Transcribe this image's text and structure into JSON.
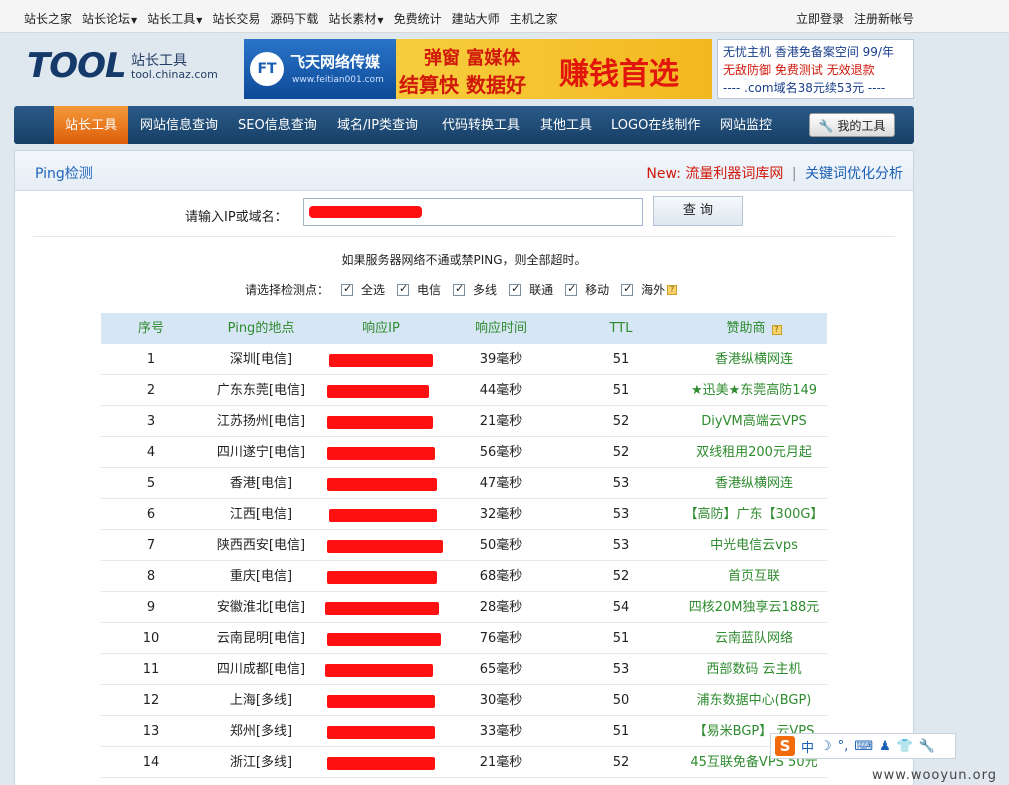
{
  "topbar": {
    "links": [
      {
        "label": "站长之家",
        "dropdown": false
      },
      {
        "label": "站长论坛",
        "dropdown": true
      },
      {
        "label": "站长工具",
        "dropdown": true
      },
      {
        "label": "站长交易",
        "dropdown": false
      },
      {
        "label": "源码下载",
        "dropdown": false
      },
      {
        "label": "站长素材",
        "dropdown": true
      },
      {
        "label": "免费统计",
        "dropdown": false
      },
      {
        "label": "建站大师",
        "dropdown": false
      },
      {
        "label": "主机之家",
        "dropdown": false
      }
    ],
    "login": "立即登录",
    "register": "注册新帐号"
  },
  "header": {
    "logo_text": "TOOL",
    "logo_cn": "站长工具",
    "logo_url": "tool.chinaz.com",
    "banner": {
      "badge": "FT",
      "brand": "飞天网络传媒",
      "brand_url": "www.feitian001.com",
      "line1": "弹窗 富媒体",
      "line2": "结算快 数据好",
      "slogan": "赚钱首选"
    },
    "text_ad": {
      "line1": "无忧主机 香港免备案空间 99/年",
      "line2": "无敌防御 免费测试 无效退款",
      "line3": "---- .com域名38元续53元 ----"
    }
  },
  "nav": {
    "items": [
      "站长工具",
      "网站信息查询",
      "SEO信息查询",
      "域名/IP类查询",
      "代码转换工具",
      "其他工具",
      "LOGO在线制作",
      "网站监控"
    ],
    "my_tools": "我的工具"
  },
  "page": {
    "title": "Ping检测",
    "new_label": "New:",
    "promo1": "流量利器词库网",
    "promo2": "关键词优化分析",
    "input_label": "请输入IP或域名：",
    "search_button": "查 询",
    "notice": "如果服务器网络不通或禁PING，则全部超时。",
    "select_label": "请选择检测点：",
    "checkboxes": [
      {
        "label": "全选",
        "checked": true
      },
      {
        "label": "电信",
        "checked": true
      },
      {
        "label": "多线",
        "checked": true
      },
      {
        "label": "联通",
        "checked": true
      },
      {
        "label": "移动",
        "checked": true
      },
      {
        "label": "海外",
        "checked": true
      }
    ]
  },
  "table": {
    "headers": [
      "序号",
      "Ping的地点",
      "响应IP",
      "响应时间",
      "TTL",
      "赞助商"
    ],
    "rows": [
      {
        "no": "1",
        "location": "深圳[电信]",
        "time": "39毫秒",
        "ttl": "51",
        "sponsor": "香港纵横网连"
      },
      {
        "no": "2",
        "location": "广东东莞[电信]",
        "time": "44毫秒",
        "ttl": "51",
        "sponsor": "★迅美★东莞高防149"
      },
      {
        "no": "3",
        "location": "江苏扬州[电信]",
        "time": "21毫秒",
        "ttl": "52",
        "sponsor": "DiyVM高端云VPS"
      },
      {
        "no": "4",
        "location": "四川遂宁[电信]",
        "time": "56毫秒",
        "ttl": "52",
        "sponsor": "双线租用200元月起"
      },
      {
        "no": "5",
        "location": "香港[电信]",
        "time": "47毫秒",
        "ttl": "53",
        "sponsor": "香港纵横网连"
      },
      {
        "no": "6",
        "location": "江西[电信]",
        "time": "32毫秒",
        "ttl": "53",
        "sponsor": "【高防】广东【300G】"
      },
      {
        "no": "7",
        "location": "陕西西安[电信]",
        "time": "50毫秒",
        "ttl": "53",
        "sponsor": "中光电信云vps"
      },
      {
        "no": "8",
        "location": "重庆[电信]",
        "time": "68毫秒",
        "ttl": "52",
        "sponsor": "首页互联"
      },
      {
        "no": "9",
        "location": "安徽淮北[电信]",
        "time": "28毫秒",
        "ttl": "54",
        "sponsor": "四核20M独享云188元"
      },
      {
        "no": "10",
        "location": "云南昆明[电信]",
        "time": "76毫秒",
        "ttl": "51",
        "sponsor": "云南蓝队网络"
      },
      {
        "no": "11",
        "location": "四川成都[电信]",
        "time": "65毫秒",
        "ttl": "53",
        "sponsor": "西部数码 云主机"
      },
      {
        "no": "12",
        "location": "上海[多线]",
        "time": "30毫秒",
        "ttl": "50",
        "sponsor": "浦东数据中心(BGP)"
      },
      {
        "no": "13",
        "location": "郑州[多线]",
        "time": "33毫秒",
        "ttl": "51",
        "sponsor": "【易米BGP】 云VPS"
      },
      {
        "no": "14",
        "location": "浙江[多线]",
        "time": "21毫秒",
        "ttl": "52",
        "sponsor": "45互联免备VPS 50元"
      }
    ]
  },
  "ime": {
    "logo": "S",
    "mode": "中"
  },
  "watermark": "www.wooyun.org",
  "colors": {
    "accent": "#1a5fb4",
    "sponsor": "#2e8b2e",
    "redaction": "#ff1111",
    "nav_active": "#e8701f"
  }
}
